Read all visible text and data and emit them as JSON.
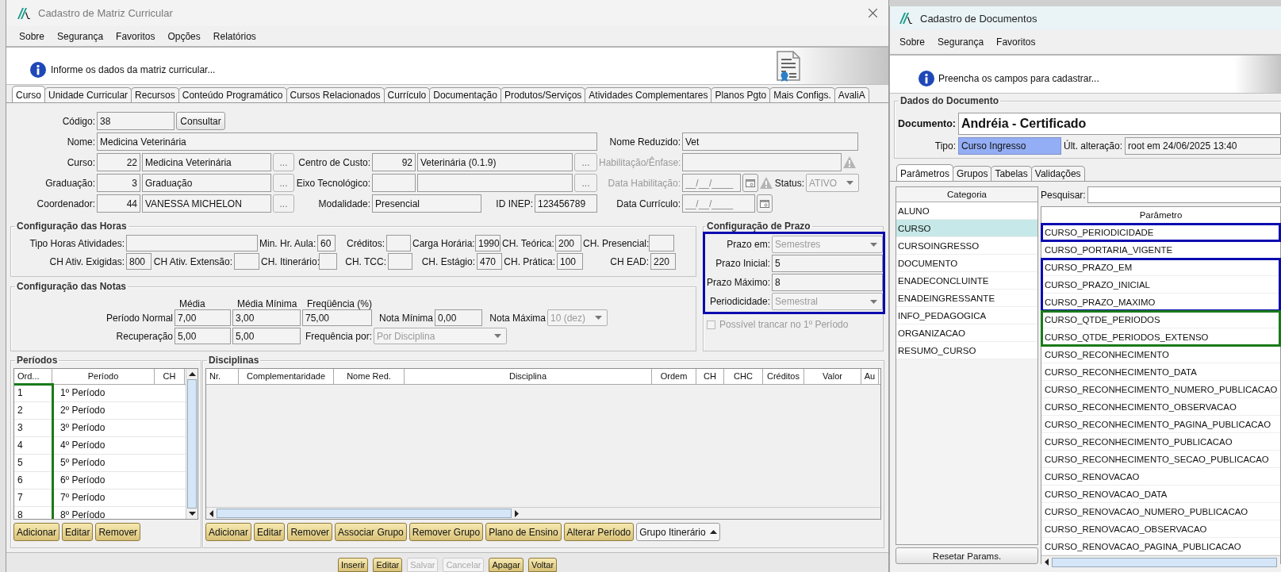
{
  "left_window": {
    "title": "Cadastro de Matriz Curricular",
    "menu": [
      "Sobre",
      "Segurança",
      "Favoritos",
      "Opções",
      "Relatórios"
    ],
    "info": "Informe os dados da matriz curricular...",
    "tabs": [
      {
        "label": "Curso",
        "selected": true
      },
      {
        "label": "Unidade Curricular",
        "selected": false
      },
      {
        "label": "Recursos",
        "selected": false
      },
      {
        "label": "Conteúdo Programático",
        "selected": false
      },
      {
        "label": "Cursos Relacionados",
        "selected": false
      },
      {
        "label": "Currículo",
        "selected": false
      },
      {
        "label": "Documentação",
        "selected": false
      },
      {
        "label": "Produtos/Serviços",
        "selected": false
      },
      {
        "label": "Atividades Complementares",
        "selected": false
      },
      {
        "label": "Planos Pgto",
        "selected": false
      },
      {
        "label": "Mais Configs.",
        "selected": false
      },
      {
        "label": "AvaliA",
        "selected": false
      }
    ],
    "form_rows": [
      [
        {
          "kind": "label",
          "text": "Código:",
          "disabled": false
        },
        {
          "kind": "field",
          "value": "38"
        },
        {
          "kind": "button",
          "label": "Consultar"
        }
      ],
      [
        {
          "kind": "label",
          "text": "Nome:",
          "disabled": false
        },
        {
          "kind": "field",
          "value": "Medicina Veterinária"
        },
        {
          "kind": "label",
          "text": "Nome Reduzido:",
          "disabled": false
        },
        {
          "kind": "field",
          "value": "Vet"
        }
      ],
      [
        {
          "kind": "label",
          "text": "Curso:",
          "disabled": false
        },
        {
          "kind": "number",
          "value": "22"
        },
        {
          "kind": "field",
          "value": "Medicina Veterinária"
        },
        {
          "kind": "lookup",
          "label": "..."
        },
        {
          "kind": "label",
          "text": "Centro de Custo:",
          "disabled": false
        },
        {
          "kind": "number",
          "value": "92"
        },
        {
          "kind": "field",
          "value": "Veterinária (0.1.9)"
        },
        {
          "kind": "lookup",
          "label": "..."
        },
        {
          "kind": "label",
          "text": "Habilitação/Ênfase:",
          "disabled": true
        },
        {
          "kind": "field"
        },
        {
          "kind": "warning"
        }
      ],
      [
        {
          "kind": "label",
          "text": "Graduação:",
          "disabled": false
        },
        {
          "kind": "number",
          "value": "3"
        },
        {
          "kind": "field",
          "value": "Graduação"
        },
        {
          "kind": "lookup",
          "label": "..."
        },
        {
          "kind": "label",
          "text": "Eixo Tecnológico:",
          "disabled": false
        },
        {
          "kind": "number"
        },
        {
          "kind": "field"
        },
        {
          "kind": "lookup",
          "label": "..."
        },
        {
          "kind": "label",
          "text": "Data Habilitação:",
          "disabled": true
        },
        {
          "kind": "date",
          "placeholder": "__/__/____"
        },
        {
          "kind": "calendar"
        },
        {
          "kind": "warning"
        },
        {
          "kind": "label",
          "text": "Status:",
          "disabled": false
        },
        {
          "kind": "select",
          "value": "ATIVO",
          "disabled": true
        }
      ],
      [
        {
          "kind": "label",
          "text": "Coordenador:",
          "disabled": false
        },
        {
          "kind": "number",
          "value": "44"
        },
        {
          "kind": "field",
          "value": "VANESSA MICHELON"
        },
        {
          "kind": "lookup",
          "label": "..."
        },
        {
          "kind": "label",
          "text": "Modalidade:",
          "disabled": false
        },
        {
          "kind": "field",
          "value": "Presencial"
        },
        {
          "kind": "label",
          "text": "ID INEP:",
          "disabled": false
        },
        {
          "kind": "field",
          "value": "123456789"
        },
        {
          "kind": "label",
          "text": "Data Currículo:",
          "disabled": false
        },
        {
          "kind": "date",
          "placeholder": "__/__/____"
        },
        {
          "kind": "calendar"
        }
      ]
    ],
    "horas": {
      "title": "Configuração das Horas",
      "fields": [
        {
          "label": "Tipo Horas Atividades:"
        },
        {
          "label": "Min. Hr. Aula:",
          "value": "60"
        },
        {
          "label": "Créditos:"
        },
        {
          "label": "Carga Horária:",
          "value": "1990"
        },
        {
          "label": "CH. Teórica:",
          "value": "200"
        },
        {
          "label": "CH. Presencial:"
        },
        {
          "label": "CH Ativ. Exigidas:",
          "value": "800"
        },
        {
          "label": "CH Ativ. Extensão:"
        },
        {
          "label": "CH. Itinerário:"
        },
        {
          "label": "CH. TCC:"
        },
        {
          "label": "CH. Estágio:",
          "value": "470"
        },
        {
          "label": "CH. Prática:",
          "value": "100"
        },
        {
          "label": "CH EAD:",
          "value": "220"
        }
      ]
    },
    "notas": {
      "title": "Configuração das Notas",
      "headers": [
        "Média",
        "Média Mínima",
        "Freqüência (%)"
      ],
      "rows": [
        [
          {
            "kind": "label",
            "text": "Período Normal"
          },
          {
            "kind": "field",
            "value": "7,00"
          },
          {
            "kind": "field",
            "value": "3,00"
          },
          {
            "kind": "field",
            "value": "75,00"
          },
          {
            "kind": "label",
            "text": "Nota Mínima"
          },
          {
            "kind": "field",
            "value": "0,00"
          },
          {
            "kind": "label",
            "text": "Nota Máxima"
          },
          {
            "kind": "select",
            "value": "10 (dez)",
            "disabled": true
          }
        ],
        [
          {
            "kind": "label",
            "text": "Recuperação"
          },
          {
            "kind": "field",
            "value": "5,00"
          },
          {
            "kind": "field",
            "value": "5,00"
          },
          {
            "kind": "label",
            "text": "Frequência por:"
          },
          {
            "kind": "select",
            "value": "Por Disciplina",
            "disabled": true
          }
        ]
      ]
    },
    "prazo": {
      "title": "Configuração de Prazo",
      "color": "#0b0bb0",
      "rows": [
        [
          {
            "kind": "label",
            "text": "Prazo em:"
          },
          {
            "kind": "select",
            "value": "Semestres",
            "disabled": true
          }
        ],
        [
          {
            "kind": "label",
            "text": "Prazo Inicial:"
          },
          {
            "kind": "field",
            "value": "5"
          }
        ],
        [
          {
            "kind": "label",
            "text": "Prazo Máximo:"
          },
          {
            "kind": "field",
            "value": "8"
          }
        ],
        [
          {
            "kind": "label",
            "text": "Periodicidade:"
          },
          {
            "kind": "select",
            "value": "Semestral",
            "disabled": true
          }
        ]
      ],
      "trancar": {
        "label": "Possível trancar no 1º Período",
        "checked": false,
        "disabled": true
      }
    },
    "periodos": {
      "title": "Períodos",
      "columns": [
        "Ord...",
        "Período",
        "CH"
      ],
      "color": "#1a7a1a",
      "rows": [
        {
          "ord": "1",
          "periodo": "1º Período"
        },
        {
          "ord": "2",
          "periodo": "2º Período"
        },
        {
          "ord": "3",
          "periodo": "3º Período"
        },
        {
          "ord": "4",
          "periodo": "4º Período"
        },
        {
          "ord": "5",
          "periodo": "5º Período"
        },
        {
          "ord": "6",
          "periodo": "6º Período"
        },
        {
          "ord": "7",
          "periodo": "7º Período"
        },
        {
          "ord": "8",
          "periodo": "8º Período"
        }
      ],
      "buttons": [
        "Adicionar",
        "Editar",
        "Remover"
      ]
    },
    "disciplinas": {
      "title": "Disciplinas",
      "columns": [
        "Nr.",
        "Complementaridade",
        "Nome Red.",
        "Disciplina",
        "Ordem",
        "CH",
        "CHC",
        "Créditos",
        "Valor",
        "Au"
      ],
      "buttons": [
        {
          "label": "Adicionar",
          "kind": "button"
        },
        {
          "label": "Editar",
          "kind": "button"
        },
        {
          "label": "Remover",
          "kind": "button"
        },
        {
          "label": "Associar Grupo",
          "kind": "button"
        },
        {
          "label": "Remover Grupo",
          "kind": "button"
        },
        {
          "label": "Plano de Ensino",
          "kind": "button"
        },
        {
          "label": "Alterar Período",
          "kind": "button"
        },
        {
          "label": "Grupo Itinerário",
          "kind": "dropdown"
        }
      ]
    },
    "actions": [
      {
        "label": "Inserir",
        "disabled": false
      },
      {
        "label": "Editar",
        "disabled": false
      },
      {
        "label": "Salvar",
        "disabled": true
      },
      {
        "label": "Cancelar",
        "disabled": true
      },
      {
        "label": "Apagar",
        "disabled": false
      },
      {
        "label": "Voltar",
        "disabled": false
      }
    ]
  },
  "right_window": {
    "title": "Cadastro de Documentos",
    "menu": [
      "Sobre",
      "Segurança",
      "Favoritos"
    ],
    "info": "Preencha os campos para cadastrar...",
    "dados": {
      "title": "Dados do Documento",
      "documento_label": "Documento:",
      "documento": "Andréia - Certificado",
      "tipo_label": "Tipo:",
      "tipo": "Curso Ingresso",
      "alteracao_label": "Últ. alteração:",
      "alteracao": "root em 24/06/2025 13:40"
    },
    "tabs": [
      {
        "label": "Parâmetros",
        "selected": true
      },
      {
        "label": "Grupos",
        "selected": false
      },
      {
        "label": "Tabelas",
        "selected": false
      },
      {
        "label": "Validações",
        "selected": false
      }
    ],
    "categoria": {
      "header": "Categoria",
      "items": [
        {
          "label": "ALUNO",
          "selected": false
        },
        {
          "label": "CURSO",
          "selected": true
        },
        {
          "label": "CURSOINGRESSO",
          "selected": false
        },
        {
          "label": "DOCUMENTO",
          "selected": false
        },
        {
          "label": "ENADECONCLUINTE",
          "selected": false
        },
        {
          "label": "ENADEINGRESSANTE",
          "selected": false
        },
        {
          "label": "INFO_PEDAGOGICA",
          "selected": false
        },
        {
          "label": "ORGANIZACAO",
          "selected": false
        },
        {
          "label": "RESUMO_CURSO",
          "selected": false
        }
      ]
    },
    "reset": "Resetar Params.",
    "search_label": "Pesquisar:",
    "param_header": "Parâmetro",
    "param_groups": [
      {
        "color": "#0b0bb0",
        "items": [
          "CURSO_PERIODICIDADE"
        ]
      },
      {
        "items": [
          "CURSO_PORTARIA_VIGENTE"
        ]
      },
      {
        "color": "#0b0bb0",
        "items": [
          "CURSO_PRAZO_EM",
          "CURSO_PRAZO_INICIAL",
          "CURSO_PRAZO_MAXIMO"
        ]
      },
      {
        "color": "#1a7a1a",
        "items": [
          "CURSO_QTDE_PERIODOS",
          "CURSO_QTDE_PERIODOS_EXTENSO"
        ]
      },
      {
        "items": [
          "CURSO_RECONHECIMENTO",
          "CURSO_RECONHECIMENTO_DATA",
          "CURSO_RECONHECIMENTO_NUMERO_PUBLICACAO",
          "CURSO_RECONHECIMENTO_OBSERVACAO",
          "CURSO_RECONHECIMENTO_PAGINA_PUBLICACAO",
          "CURSO_RECONHECIMENTO_PUBLICACAO",
          "CURSO_RECONHECIMENTO_SECAO_PUBLICACAO",
          "CURSO_RENOVACAO",
          "CURSO_RENOVACAO_DATA",
          "CURSO_RENOVACAO_NUMERO_PUBLICACAO",
          "CURSO_RENOVACAO_OBSERVACAO",
          "CURSO_RENOVACAO_PAGINA_PUBLICACAO"
        ]
      }
    ]
  }
}
